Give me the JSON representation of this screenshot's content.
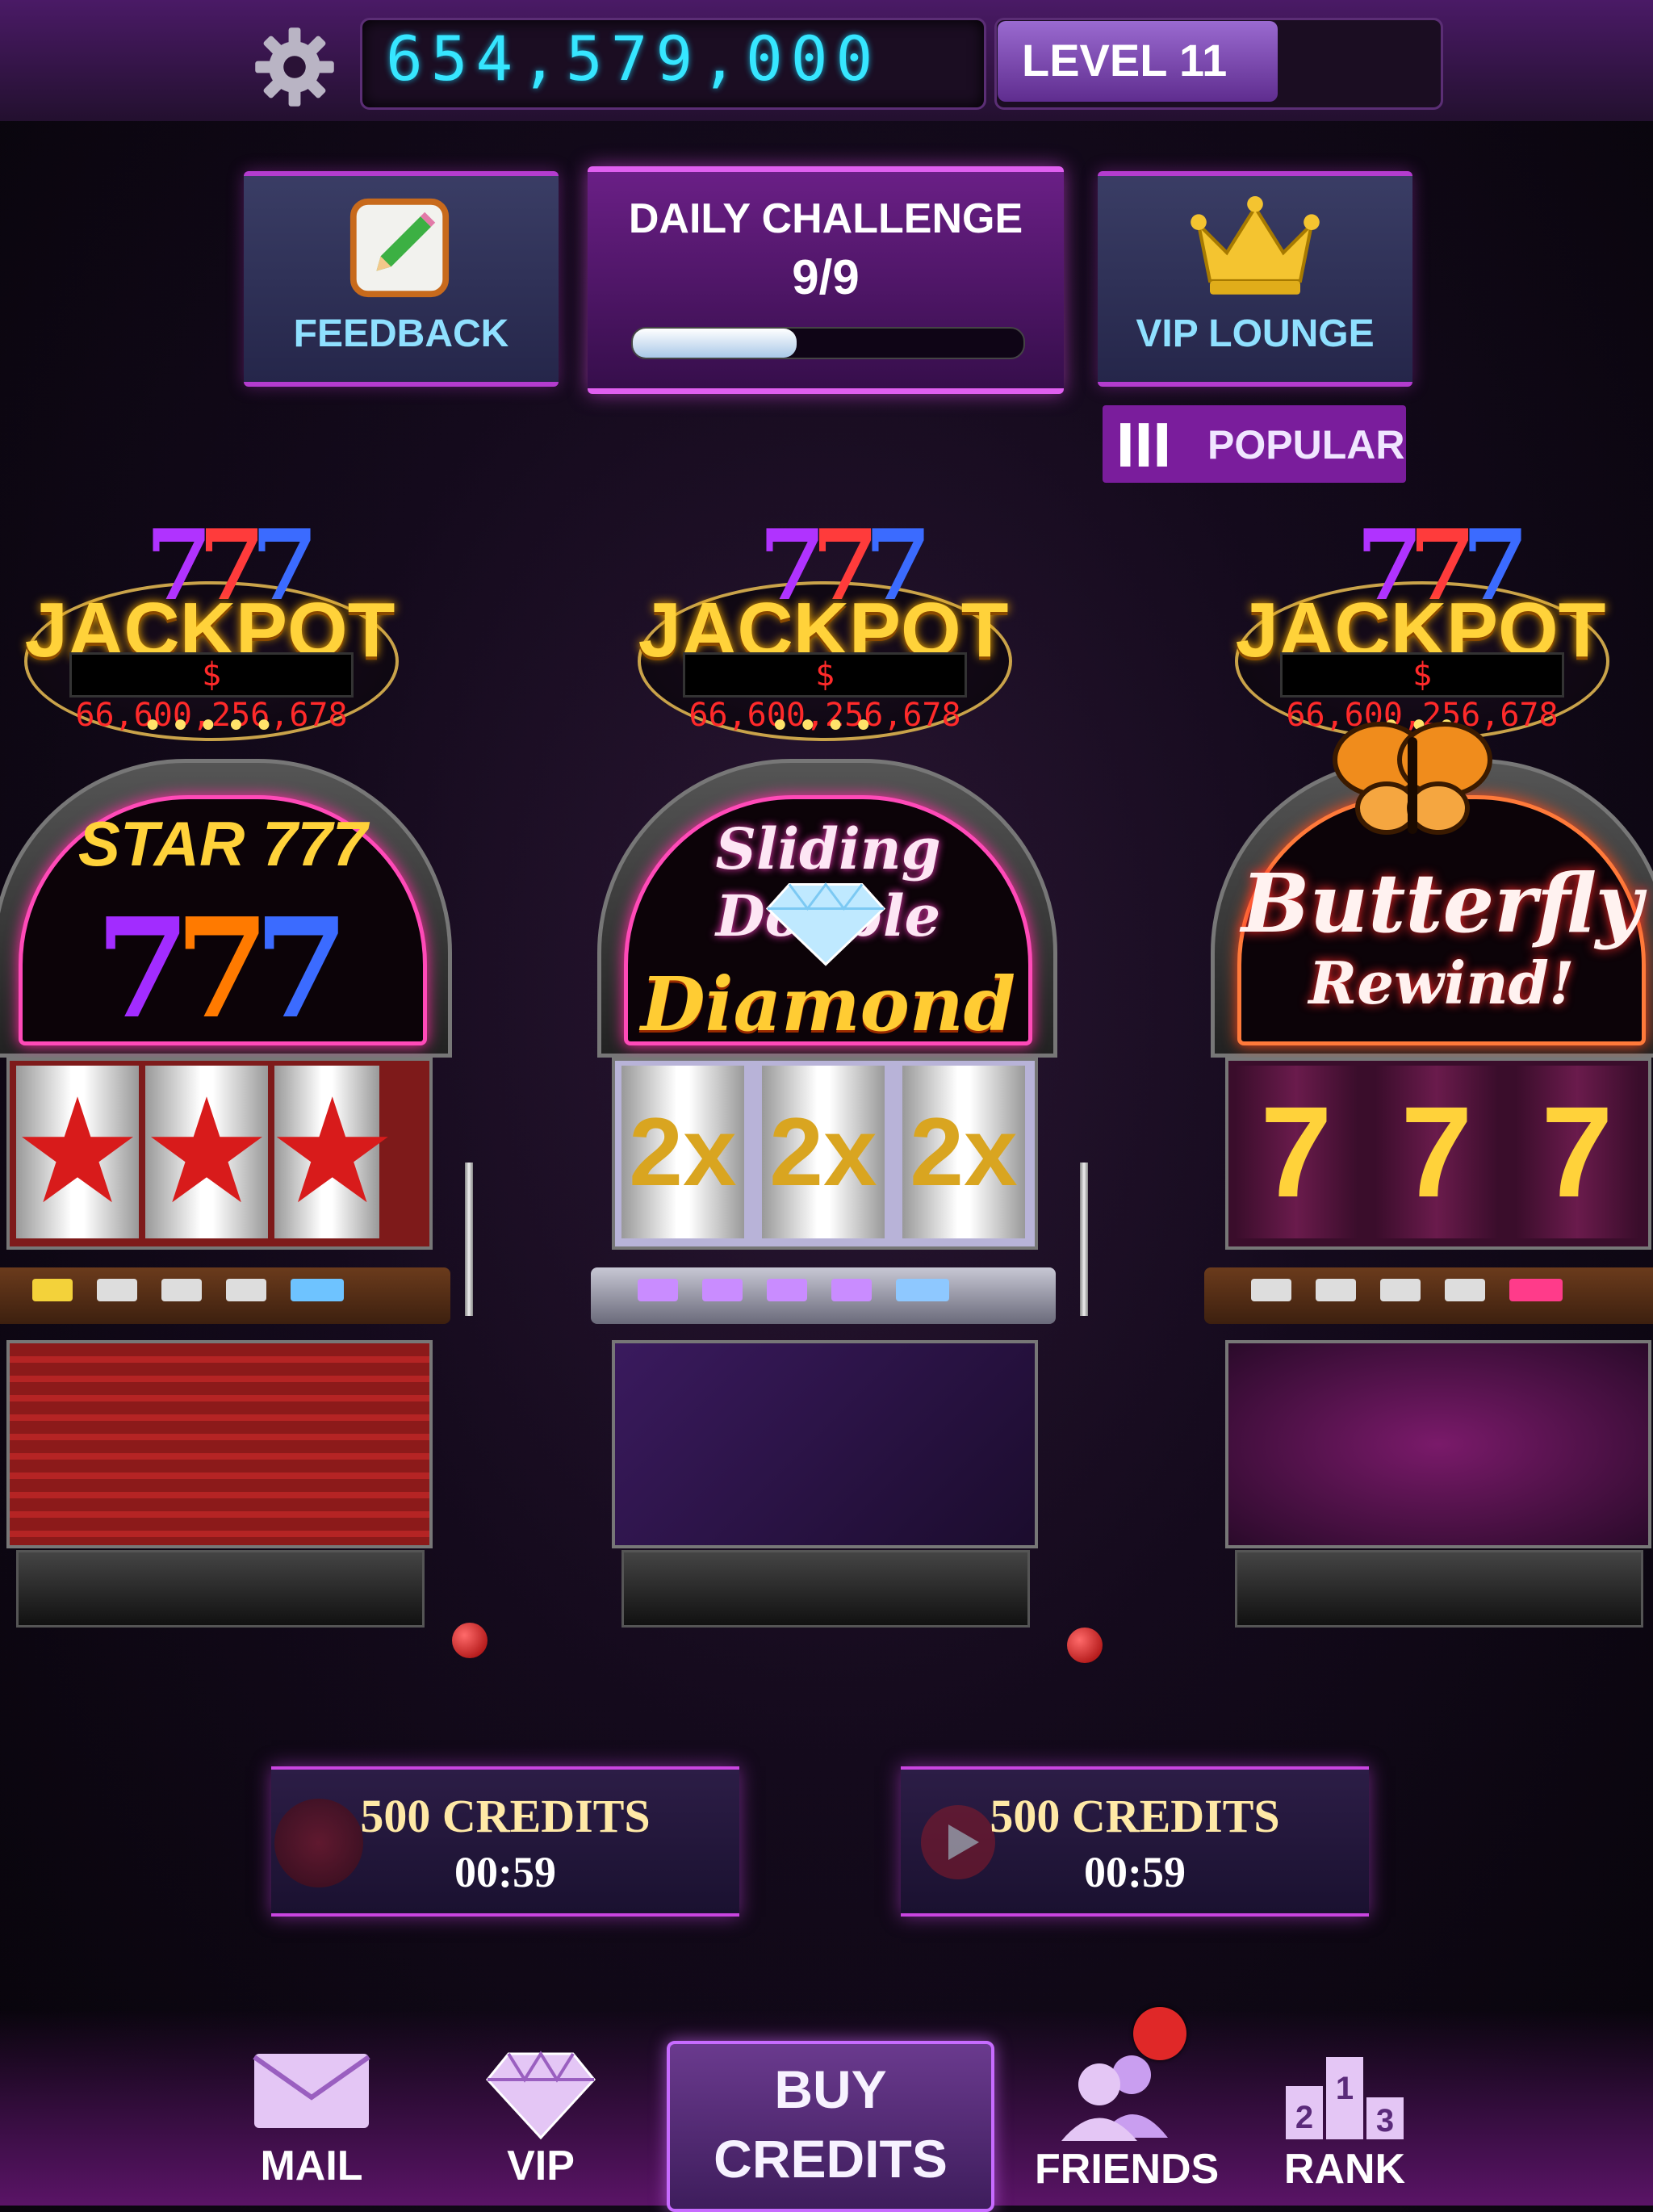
{
  "header": {
    "credits": "654,579,000",
    "level_label": "LEVEL 11",
    "level_progress": 0.63
  },
  "panels": {
    "feedback_label": "FEEDBACK",
    "challenge_title": "DAILY CHALLENGE",
    "challenge_progress_text": "9/9",
    "challenge_progress": 0.42,
    "vip_label": "VIP LOUNGE"
  },
  "sort": {
    "label": "POPULAR"
  },
  "machines": [
    {
      "jackpot_label": "JACKPOT",
      "jackpot_amount": "66,600,256,678",
      "title": "STAR 777"
    },
    {
      "jackpot_label": "JACKPOT",
      "jackpot_amount": "66,600,256,678",
      "title_top": "Sliding Double",
      "title_bottom": "Diamond"
    },
    {
      "jackpot_label": "JACKPOT",
      "jackpot_amount": "66,600,256,678",
      "title_top": "Butterfly",
      "title_bottom": "Rewind!"
    }
  ],
  "bonuses": [
    {
      "title": "500 CREDITS",
      "timer": "00:59"
    },
    {
      "title": "500 CREDITS",
      "timer": "00:59"
    }
  ],
  "nav": {
    "mail": "MAIL",
    "vip": "VIP",
    "buy_line1": "BUY",
    "buy_line2": "CREDITS",
    "friends": "FRIENDS",
    "rank": "RANK"
  },
  "colors": {
    "accent": "#b43ccf",
    "credits_text": "#36e6ff",
    "jackpot_text": "#ffd23a",
    "badge": "#e02828"
  }
}
